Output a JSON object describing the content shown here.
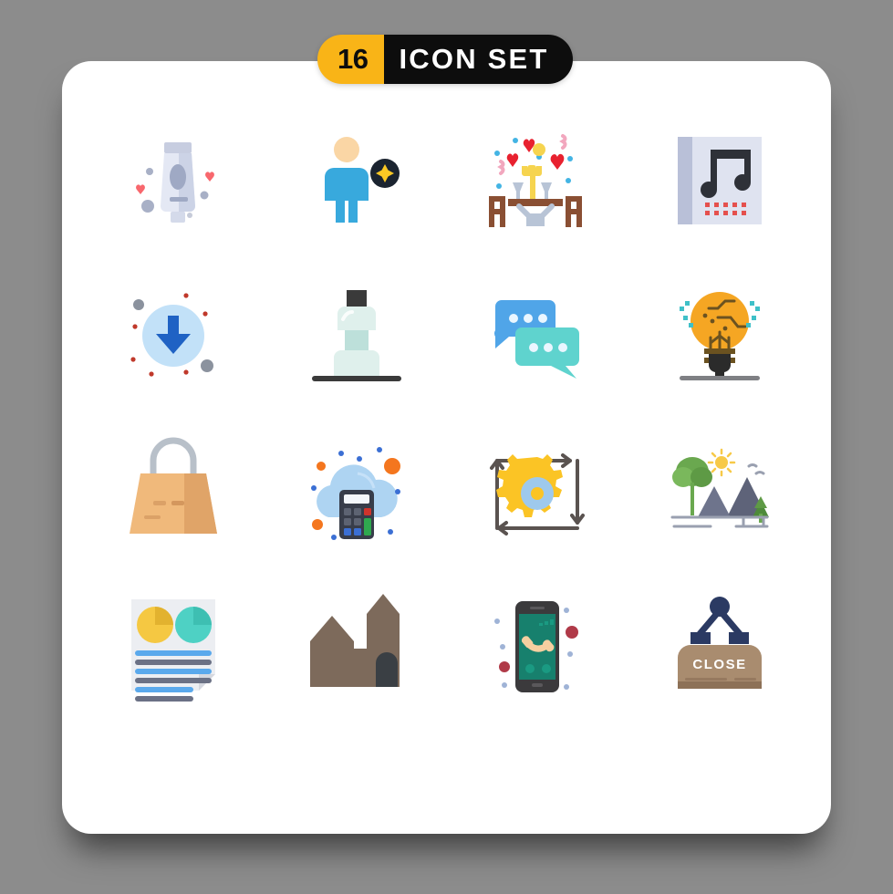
{
  "header": {
    "count": "16",
    "title": "ICON SET",
    "badge_number_bg": "#f9b417",
    "badge_text_bg": "#0d0d0d",
    "badge_number_color": "#0d0d0d",
    "badge_text_color": "#ffffff"
  },
  "page": {
    "background": "#8c8c8c",
    "card_background": "#ffffff"
  },
  "grid": {
    "columns": 4,
    "rows": 4,
    "total": 16
  },
  "icons": [
    {
      "index": 1,
      "name": "cosmetic-tube-icon",
      "label": "Cosmetic lotion tube with hearts",
      "row": 1,
      "col": 1,
      "colors": [
        "#d8dbe8",
        "#c3c8dc",
        "#f2f3f7",
        "#f4656c",
        "#a9b0c7"
      ]
    },
    {
      "index": 2,
      "name": "person-star-icon",
      "label": "Person avatar with star badge",
      "row": 1,
      "col": 2,
      "colors": [
        "#36a9dd",
        "#f9d6a0",
        "#1b2430",
        "#fbc824"
      ]
    },
    {
      "index": 3,
      "name": "romantic-dinner-icon",
      "label": "Romantic dinner table with hearts",
      "row": 1,
      "col": 3,
      "colors": [
        "#8a4f33",
        "#e8212f",
        "#f6d44f",
        "#b8c4d6",
        "#43b4e4"
      ]
    },
    {
      "index": 4,
      "name": "music-album-icon",
      "label": "Music album with note",
      "row": 1,
      "col": 4,
      "colors": [
        "#dfe3f0",
        "#b9c0d8",
        "#2e3138",
        "#e5504d"
      ]
    },
    {
      "index": 5,
      "name": "download-arrow-icon",
      "label": "Download arrow in circle",
      "row": 2,
      "col": 1,
      "colors": [
        "#c2e1f8",
        "#1f62c4",
        "#c0392b",
        "#8b929e"
      ]
    },
    {
      "index": 6,
      "name": "mouthwash-bottle-icon",
      "label": "Mouthwash bottle",
      "row": 2,
      "col": 2,
      "colors": [
        "#dff0ec",
        "#bde0da",
        "#3a3a3a"
      ]
    },
    {
      "index": 7,
      "name": "chat-bubbles-icon",
      "label": "Two chat bubbles",
      "row": 2,
      "col": 3,
      "colors": [
        "#50a5e8",
        "#5fd3ce",
        "#eaf6ff"
      ]
    },
    {
      "index": 8,
      "name": "idea-lightbulb-icon",
      "label": "Lightbulb with circuit",
      "row": 2,
      "col": 4,
      "colors": [
        "#f5a623",
        "#6b5220",
        "#2b2b2b",
        "#7f8084",
        "#3fc0c8"
      ]
    },
    {
      "index": 9,
      "name": "shopping-bag-icon",
      "label": "Shopping bag",
      "row": 3,
      "col": 1,
      "colors": [
        "#f0b97b",
        "#e0a468",
        "#b8c0c9"
      ]
    },
    {
      "index": 10,
      "name": "cloud-calculator-icon",
      "label": "Cloud computing calculator",
      "row": 3,
      "col": 2,
      "colors": [
        "#aed4f2",
        "#383d4a",
        "#f4761e",
        "#3b6fd4",
        "#2fa84f",
        "#d0342c"
      ]
    },
    {
      "index": 11,
      "name": "gear-process-icon",
      "label": "Gear with cycle arrows",
      "row": 3,
      "col": 3,
      "colors": [
        "#fbc425",
        "#9ec9ec",
        "#5a5350"
      ]
    },
    {
      "index": 12,
      "name": "landscape-mountain-icon",
      "label": "Mountain landscape with sun",
      "row": 3,
      "col": 4,
      "colors": [
        "#5e6379",
        "#6aa84f",
        "#f7c948",
        "#9aa0b0"
      ]
    },
    {
      "index": 13,
      "name": "report-document-icon",
      "label": "Report document with pie charts",
      "row": 4,
      "col": 1,
      "colors": [
        "#eceef2",
        "#f5c842",
        "#4ed1c4",
        "#5aa9ec",
        "#6b7185"
      ]
    },
    {
      "index": 14,
      "name": "church-building-icon",
      "label": "Church building silhouette",
      "row": 4,
      "col": 2,
      "colors": [
        "#7d6a5b",
        "#3a3f44"
      ]
    },
    {
      "index": 15,
      "name": "smartphone-call-icon",
      "label": "Smartphone incoming call",
      "row": 4,
      "col": 3,
      "colors": [
        "#3b3a3c",
        "#17806d",
        "#f5cfa0",
        "#b03a48",
        "#9fb3d6"
      ]
    },
    {
      "index": 16,
      "name": "close-sign-icon",
      "label": "Hanging CLOSE sign",
      "row": 4,
      "col": 4,
      "colors": [
        "#a98c6f",
        "#2b3a63",
        "#ffffff",
        "#8d7157"
      ]
    }
  ],
  "sign": {
    "close_text": "CLOSE"
  }
}
